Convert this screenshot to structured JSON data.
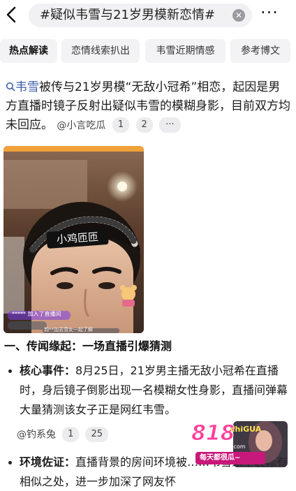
{
  "header": {
    "back_icon": "chevron-left-icon",
    "search_query": "#疑似韦雪与21岁男模新恋情#",
    "clear_icon": "clear-circle-icon",
    "more_icon": "more-dots-icon",
    "more_label": "···"
  },
  "tabs": [
    {
      "label": "热点解读",
      "active": true
    },
    {
      "label": "恋情线索扒出",
      "active": false
    },
    {
      "label": "韦雪近期情感",
      "active": false
    },
    {
      "label": "参考博文",
      "active": false
    }
  ],
  "summary": {
    "link": "韦雪",
    "text": "被传与21岁男模“无敌小冠希”相恋，起因是男方直播时镜子反射出疑似韦雪的模糊身影，目前双方均未回应。",
    "source": "@小言吃瓜",
    "refs": [
      "1",
      "2"
    ],
    "more": "···"
  },
  "photo": {
    "caption": "小鸡匝匝",
    "chat_lines": [
      "加入了直播间",
      "*****",
      "韵**加志雪女一起了解"
    ]
  },
  "section": {
    "heading": "一、传闻缘起：一场直播引爆猜测",
    "items": [
      {
        "title": "核心事件：",
        "text": "8月25日，21岁男主播无敌小冠希在直播时，身后镜子倒影出现一名模糊女性身影，直播间弹幕大量猜测该女子正是网红韦雪。",
        "source": "@钓系兔",
        "refs": [
          "1",
          "25"
        ]
      },
      {
        "title": "环境佐证：",
        "text": "直播背景的房间环境被……韦雪家中装修有相似之处，进一步加深了网友怀"
      }
    ]
  },
  "watermark": {
    "brand": "818",
    "sub": "chiGUA",
    "site": "818chigua.com",
    "tagline": "每天都很瓜~"
  }
}
